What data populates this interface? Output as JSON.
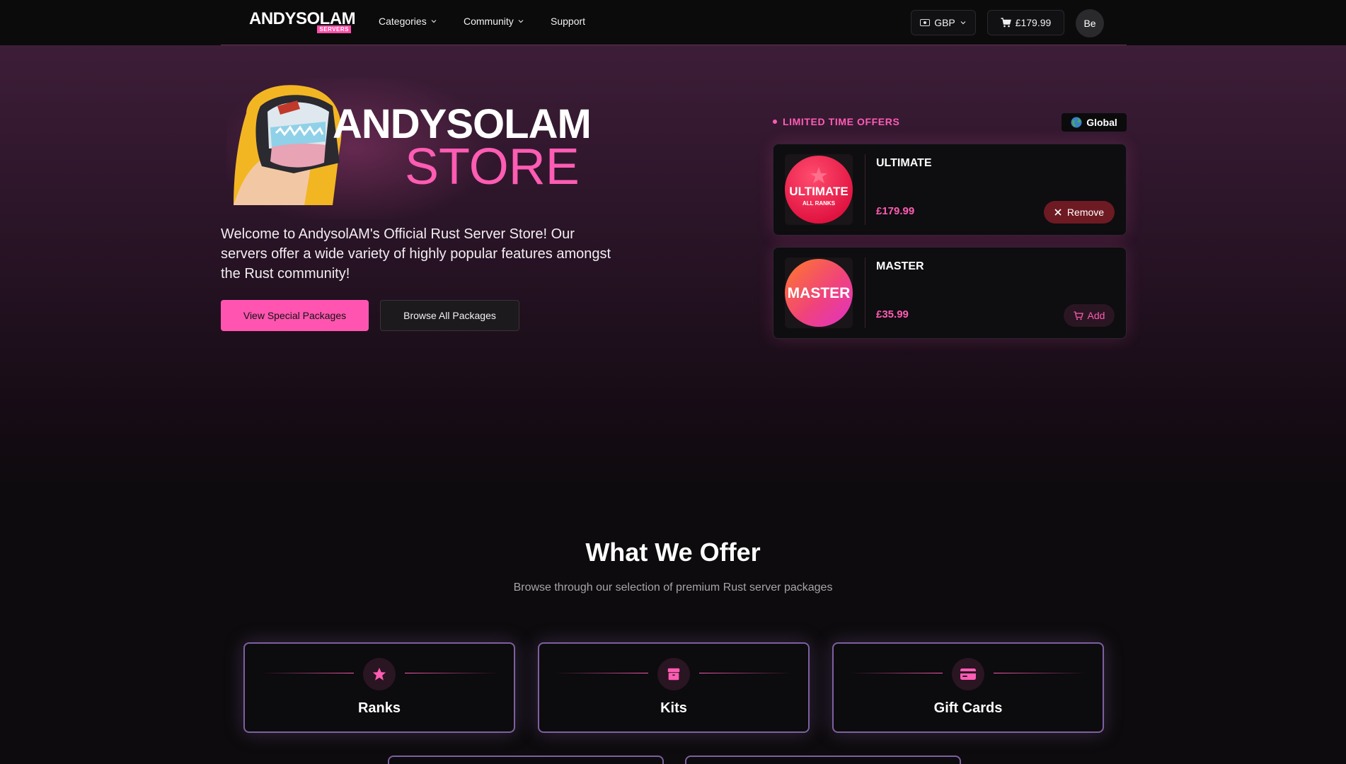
{
  "nav": {
    "logo_main": "ANDYSOLAM",
    "logo_sub": "SERVERS",
    "items": [
      {
        "label": "Categories",
        "has_dropdown": true
      },
      {
        "label": "Community",
        "has_dropdown": true
      },
      {
        "label": "Support",
        "has_dropdown": false
      }
    ],
    "currency": "GBP",
    "cart_total": "£179.99",
    "avatar_initials": "Be"
  },
  "hero": {
    "logo_line1": "ANDYSOLAM",
    "logo_line2": "STORE",
    "description": "Welcome to AndysolAM's Official Rust Server Store! Our servers offer a wide variety of highly popular features amongst the Rust community!",
    "primary_button": "View Special Packages",
    "secondary_button": "Browse All Packages"
  },
  "offers": {
    "heading": "LIMITED TIME OFFERS",
    "region_badge": "Global",
    "items": [
      {
        "name": "ULTIMATE",
        "badge_text": "ULTIMATE",
        "badge_sub": "ALL RANKS",
        "price": "£179.99",
        "action": "Remove",
        "in_cart": true
      },
      {
        "name": "MASTER",
        "badge_text": "MASTER",
        "badge_sub": "",
        "price": "£35.99",
        "action": "Add",
        "in_cart": false
      }
    ]
  },
  "offer_section": {
    "title": "What We Offer",
    "subtitle": "Browse through our selection of premium Rust server packages",
    "categories": [
      {
        "label": "Ranks",
        "icon": "star-icon"
      },
      {
        "label": "Kits",
        "icon": "package-icon"
      },
      {
        "label": "Gift Cards",
        "icon": "credit-card-icon"
      }
    ]
  },
  "colors": {
    "accent": "#ff55b0",
    "background": "#0d0b0d",
    "card_border": "#7e5fa0",
    "remove_bg": "#6e1a22"
  }
}
